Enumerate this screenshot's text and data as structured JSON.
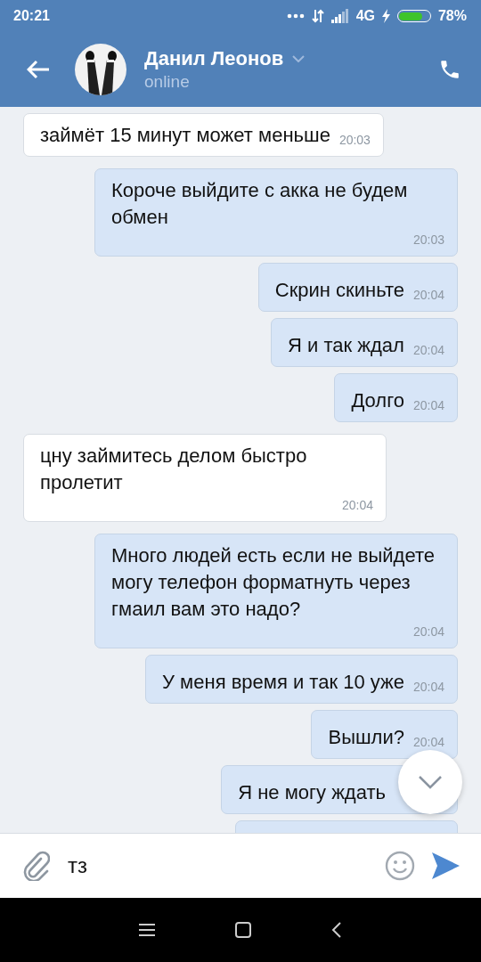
{
  "status_bar": {
    "time": "20:21",
    "network": "4G",
    "battery": {
      "level": 0.78,
      "reading": "78%"
    }
  },
  "header": {
    "name": "Данил Леонов",
    "status": "online"
  },
  "messages": [
    {
      "kind": "in",
      "text": "займёт 15 минут может меньше",
      "time": "20:03"
    },
    {
      "kind": "out",
      "text": "Короче выйдите с акка не будем обмен",
      "time": "20:03"
    },
    {
      "kind": "out",
      "text": "Скрин скиньте",
      "time": "20:04"
    },
    {
      "kind": "out",
      "text": "Я и так ждал",
      "time": "20:04"
    },
    {
      "kind": "out",
      "text": "Долго",
      "time": "20:04"
    },
    {
      "kind": "in",
      "text": "цну займитесь делом быстро пролетит",
      "time": "20:04"
    },
    {
      "kind": "out",
      "text": "Много людей есть если не выйдете могу телефон форматнуть через гмаил вам это надо?",
      "time": "20:04"
    },
    {
      "kind": "out",
      "text": "У меня время и так 10 уже",
      "time": "20:04"
    },
    {
      "kind": "out",
      "text": "Вышли?",
      "time": "20:04"
    },
    {
      "kind": "out",
      "text": "Я не могу ждать"
    },
    {
      "kind": "out"
    }
  ],
  "composer": {
    "value": "тз"
  }
}
